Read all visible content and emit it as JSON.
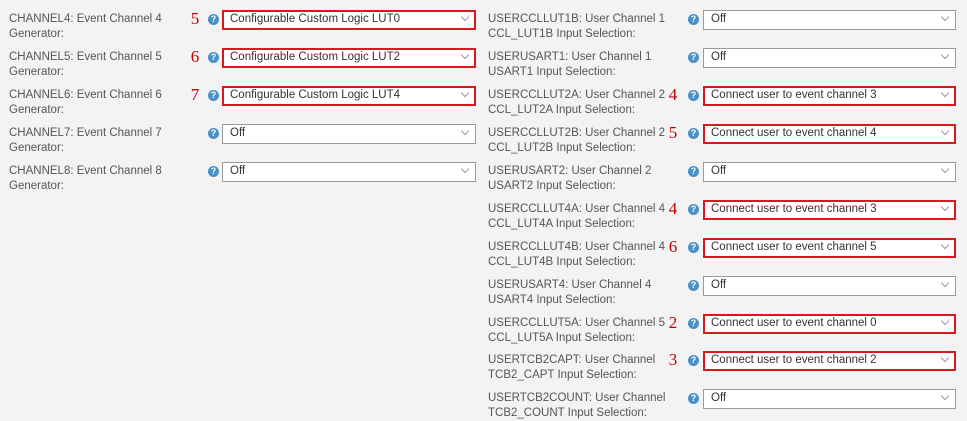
{
  "left_rows": [
    {
      "label": "CHANNEL4: Event Channel 4 Generator:",
      "num": "5",
      "value": "Configurable Custom Logic LUT0",
      "highlight": true
    },
    {
      "label": "CHANNEL5: Event Channel 5 Generator:",
      "num": "6",
      "value": "Configurable Custom Logic LUT2",
      "highlight": true
    },
    {
      "label": "CHANNEL6: Event Channel 6 Generator:",
      "num": "7",
      "value": "Configurable Custom Logic LUT4",
      "highlight": true
    },
    {
      "label": "CHANNEL7: Event Channel 7 Generator:",
      "num": "",
      "value": "Off",
      "highlight": false
    },
    {
      "label": "CHANNEL8: Event Channel 8 Generator:",
      "num": "",
      "value": "Off",
      "highlight": false
    }
  ],
  "right_rows": [
    {
      "label": "USERCCLLUT1B: User Channel 1 CCL_LUT1B Input Selection:",
      "num": "",
      "value": "Off",
      "highlight": false
    },
    {
      "label": "USERUSART1: User Channel 1 USART1 Input Selection:",
      "num": "",
      "value": "Off",
      "highlight": false
    },
    {
      "label": "USERCCLLUT2A: User Channel 2 CCL_LUT2A Input Selection:",
      "num": "4",
      "value": "Connect user to event channel 3",
      "highlight": true
    },
    {
      "label": "USERCCLLUT2B: User Channel 2 CCL_LUT2B Input Selection:",
      "num": "5",
      "value": "Connect user to event channel 4",
      "highlight": true
    },
    {
      "label": "USERUSART2: User Channel 2 USART2 Input Selection:",
      "num": "",
      "value": "Off",
      "highlight": false
    },
    {
      "label": "USERCCLLUT4A: User Channel 4 CCL_LUT4A Input Selection:",
      "num": "4",
      "value": "Connect user to event channel 3",
      "highlight": true
    },
    {
      "label": "USERCCLLUT4B: User Channel 4 CCL_LUT4B Input Selection:",
      "num": "6",
      "value": "Connect user to event channel 5",
      "highlight": true
    },
    {
      "label": "USERUSART4: User Channel 4 USART4 Input Selection:",
      "num": "",
      "value": "Off",
      "highlight": false
    },
    {
      "label": "USERCCLLUT5A: User Channel 5 CCL_LUT5A Input Selection:",
      "num": "2",
      "value": "Connect user to event channel 0",
      "highlight": true
    },
    {
      "label": "USERTCB2CAPT: User Channel TCB2_CAPT Input Selection:",
      "num": "3",
      "value": "Connect user to event channel 2",
      "highlight": true
    },
    {
      "label": "USERTCB2COUNT: User Channel TCB2_COUNT Input Selection:",
      "num": "",
      "value": "Off",
      "highlight": false
    }
  ],
  "help_icon": {
    "glyph": "?",
    "color": "#4a90c8"
  },
  "highlight_color": "#d9181e",
  "annotation_color": "#c00000"
}
